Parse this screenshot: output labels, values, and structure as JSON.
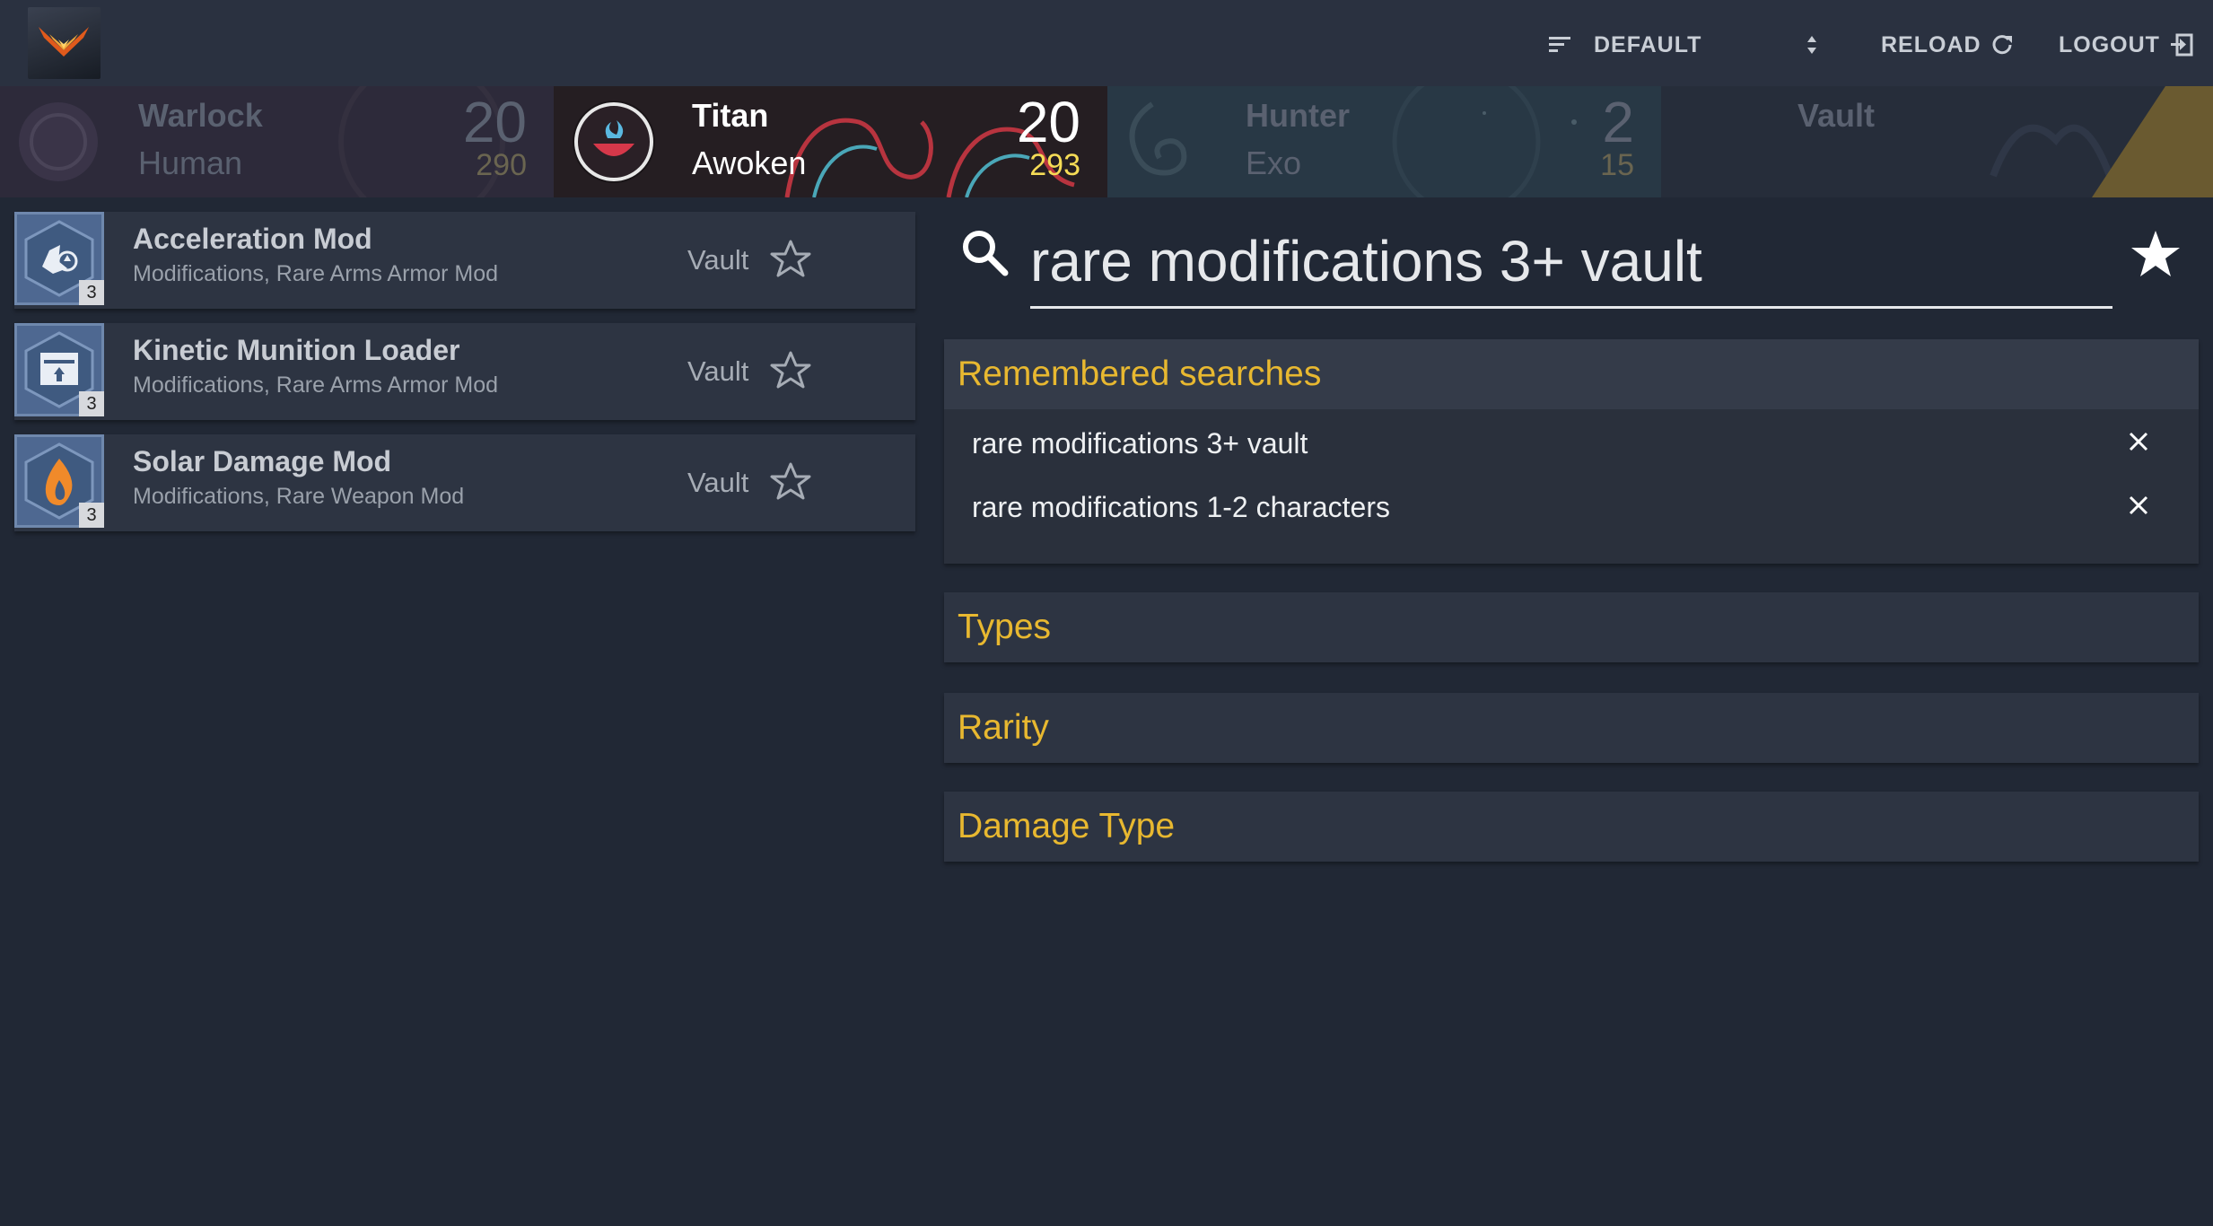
{
  "header": {
    "sort_label": "DEFAULT",
    "reload_label": "RELOAD",
    "logout_label": "LOGOUT"
  },
  "characters": [
    {
      "name": "Warlock",
      "race": "Human",
      "level": "20",
      "power": "290",
      "active": false
    },
    {
      "name": "Titan",
      "race": "Awoken",
      "level": "20",
      "power": "293",
      "active": true
    },
    {
      "name": "Hunter",
      "race": "Exo",
      "level": "2",
      "power": "15",
      "active": false
    },
    {
      "name": "Vault",
      "active": false
    }
  ],
  "items": [
    {
      "name": "Acceleration Mod",
      "desc": "Modifications, Rare Arms Armor Mod",
      "location": "Vault",
      "qty": "3",
      "icon": "acceleration-mod-icon"
    },
    {
      "name": "Kinetic Munition Loader",
      "desc": "Modifications, Rare Arms Armor Mod",
      "location": "Vault",
      "qty": "3",
      "icon": "kinetic-munition-loader-icon"
    },
    {
      "name": "Solar Damage Mod",
      "desc": "Modifications, Rare Weapon Mod",
      "location": "Vault",
      "qty": "3",
      "icon": "solar-damage-mod-icon"
    }
  ],
  "search": {
    "value": "rare modifications 3+ vault"
  },
  "remembered": {
    "title": "Remembered searches",
    "entries": [
      "rare modifications 3+ vault",
      "rare modifications 1-2 characters"
    ]
  },
  "filters": {
    "types": "Types",
    "rarity": "Rarity",
    "damage": "Damage Type"
  },
  "colors": {
    "background": "#212835",
    "accent_gold": "#e8b830",
    "power_yellow": "#f5dc56",
    "mod_blue": "#4e6891"
  }
}
